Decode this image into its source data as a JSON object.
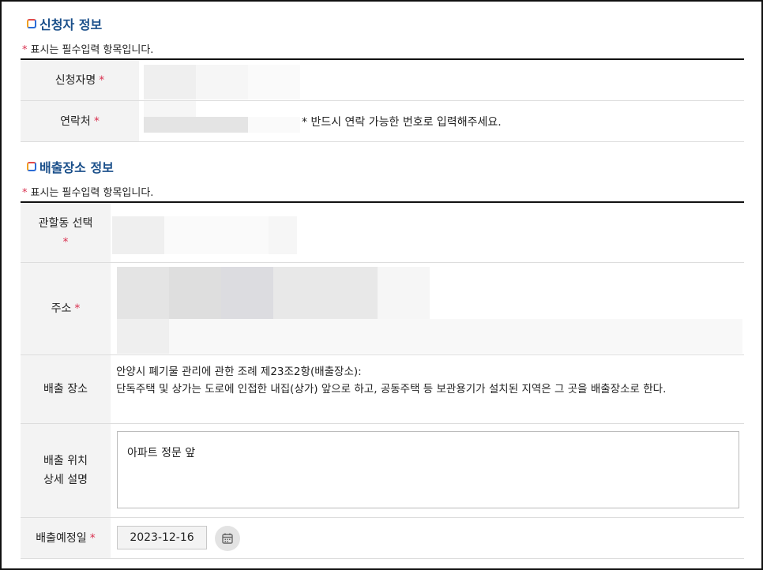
{
  "applicant_section": {
    "title": "신청자 정보",
    "required_note": "표시는 필수입력 항목입니다.",
    "name_label": "신청자명",
    "contact_label": "연락처",
    "contact_hint": "* 반드시 연락 가능한 번호로 입력해주세요."
  },
  "location_section": {
    "title": "배출장소 정보",
    "required_note": "표시는 필수입력 항목입니다.",
    "district_label": "관할동 선택",
    "address_label": "주소",
    "place_label": "배출 장소",
    "place_desc_line1": "안양시 폐기물 관리에 관한 조례 제23조2항(배출장소):",
    "place_desc_line2": "단독주택 및 상가는 도로에 인접한 내집(상가) 앞으로 하고, 공동주택 등 보관용기가 설치된 지역은 그 곳을 배출장소로 한다.",
    "detail_label_line1": "배출 위치",
    "detail_label_line2": "상세 설명",
    "detail_value": "아파트 정문 앞",
    "date_label": "배출예정일",
    "date_value": "2023-12-16"
  },
  "required_mark": "*",
  "colors": {
    "accent": "#1a4f8a",
    "required": "#d9304f"
  }
}
